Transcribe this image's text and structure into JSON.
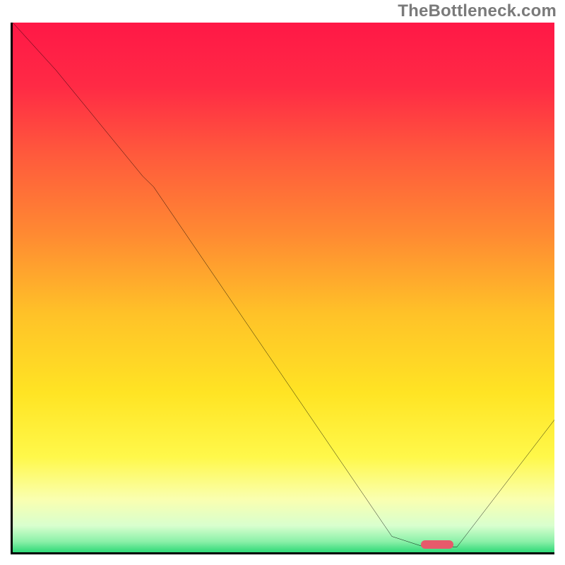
{
  "watermark": "TheBottleneck.com",
  "chart_data": {
    "type": "line",
    "title": "",
    "xlabel": "",
    "ylabel": "",
    "xlim": [
      0,
      100
    ],
    "ylim": [
      0,
      100
    ],
    "series": [
      {
        "name": "bottleneck-curve",
        "x": [
          0,
          8,
          24,
          26,
          70,
          76,
          82,
          100
        ],
        "values": [
          100,
          91,
          71,
          69,
          3,
          1,
          1,
          25
        ]
      }
    ],
    "marker": {
      "x_start": 75,
      "x_end": 81,
      "y": 1
    },
    "gradient_stops": [
      {
        "pct": 0,
        "color": "#ff1846"
      },
      {
        "pct": 12,
        "color": "#ff2a45"
      },
      {
        "pct": 25,
        "color": "#ff5a3c"
      },
      {
        "pct": 40,
        "color": "#ff8a32"
      },
      {
        "pct": 55,
        "color": "#ffc228"
      },
      {
        "pct": 70,
        "color": "#ffe424"
      },
      {
        "pct": 82,
        "color": "#fff84a"
      },
      {
        "pct": 90,
        "color": "#faffb0"
      },
      {
        "pct": 95,
        "color": "#d8ffce"
      },
      {
        "pct": 98,
        "color": "#8af0a8"
      },
      {
        "pct": 100,
        "color": "#2fd977"
      }
    ]
  }
}
